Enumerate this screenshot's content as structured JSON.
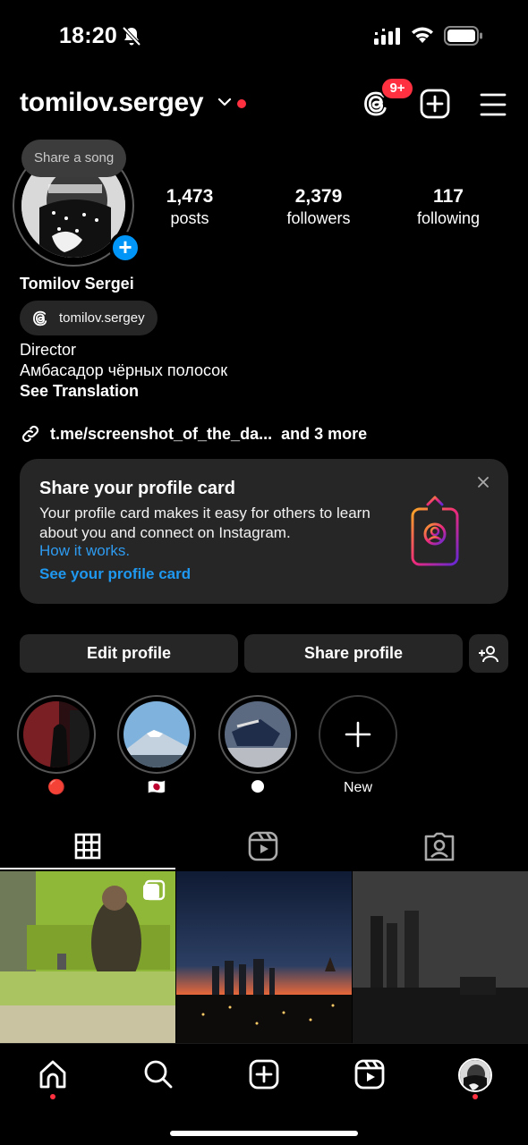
{
  "status_bar": {
    "time": "18:20"
  },
  "header": {
    "username": "tomilov.sergey",
    "notification_badge": "9+"
  },
  "profile": {
    "song_prompt": "Share a song",
    "full_name": "Tomilov Sergei",
    "threads_handle": "tomilov.sergey",
    "bio_line1": "Director",
    "bio_line2": "Амбасадор чёрных полосок",
    "see_translation": "See Translation",
    "link_url": "t.me/screenshot_of_the_da...",
    "link_more": "and 3 more"
  },
  "stats": [
    {
      "value": "1,473",
      "label": "posts"
    },
    {
      "value": "2,379",
      "label": "followers"
    },
    {
      "value": "117",
      "label": "following"
    }
  ],
  "profile_card": {
    "title": "Share your profile card",
    "text": "Your profile card makes it easy for others to learn about you and connect on Instagram.",
    "how_link": "How it works.",
    "see_link": "See your profile card"
  },
  "buttons": {
    "edit": "Edit profile",
    "share": "Share profile"
  },
  "highlights": [
    {
      "caption": "🔴"
    },
    {
      "caption": "🇯🇵"
    },
    {
      "caption": "🌑"
    },
    {
      "caption": "New"
    }
  ],
  "colors": {
    "accent_blue": "#0095f6",
    "notification_red": "#ff3040",
    "card_bg": "#262626"
  },
  "icons": {
    "status": [
      "bell-slash-icon",
      "signal-icon",
      "wifi-icon",
      "battery-icon"
    ],
    "header": [
      "chevron-down-icon",
      "threads-icon",
      "plus-square-icon",
      "menu-icon"
    ],
    "tabs": [
      "grid-icon",
      "reels-icon",
      "tagged-icon"
    ],
    "nav": [
      "home-icon",
      "search-icon",
      "create-icon",
      "reels-icon",
      "profile-avatar"
    ]
  }
}
